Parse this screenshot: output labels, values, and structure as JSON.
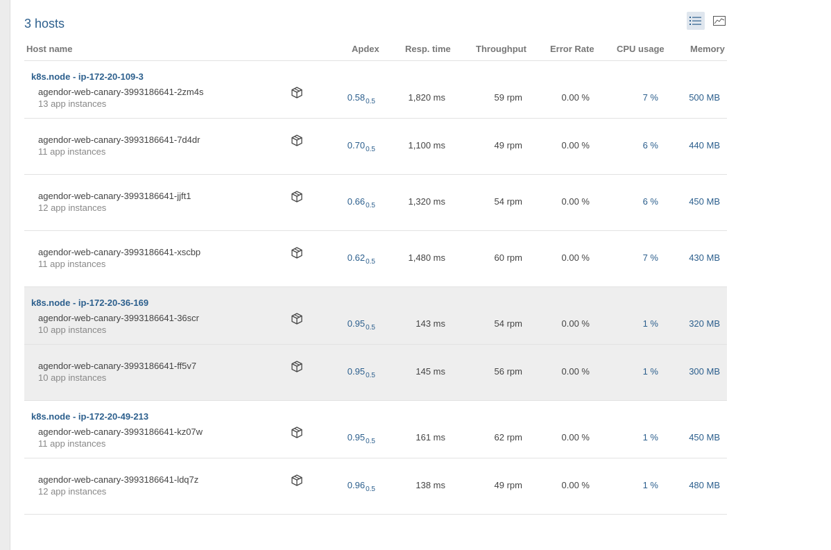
{
  "header": {
    "title": "3 hosts",
    "list_view_icon": "list-icon",
    "chart_view_icon": "chart-icon"
  },
  "columns": {
    "host_name": "Host name",
    "apdex": "Apdex",
    "resp_time": "Resp. time",
    "throughput": "Throughput",
    "error_rate": "Error Rate",
    "cpu_usage": "CPU usage",
    "memory": "Memory"
  },
  "rows": [
    {
      "host": "k8s.node - ip-172-20-109-3",
      "name": "agendor-web-canary-3993186641-2zm4s",
      "instances": "13 app instances",
      "apdex": "0.58",
      "apdex_t": "0.5",
      "resp": "1,820 ms",
      "thr": "59 rpm",
      "err": "0.00 %",
      "cpu": "7 %",
      "mem": "500 MB"
    },
    {
      "host": "",
      "name": "agendor-web-canary-3993186641-7d4dr",
      "instances": "11 app instances",
      "apdex": "0.70",
      "apdex_t": "0.5",
      "resp": "1,100 ms",
      "thr": "49 rpm",
      "err": "0.00 %",
      "cpu": "6 %",
      "mem": "440 MB"
    },
    {
      "host": "",
      "name": "agendor-web-canary-3993186641-jjft1",
      "instances": "12 app instances",
      "apdex": "0.66",
      "apdex_t": "0.5",
      "resp": "1,320 ms",
      "thr": "54 rpm",
      "err": "0.00 %",
      "cpu": "6 %",
      "mem": "450 MB"
    },
    {
      "host": "",
      "name": "agendor-web-canary-3993186641-xscbp",
      "instances": "11 app instances",
      "apdex": "0.62",
      "apdex_t": "0.5",
      "resp": "1,480 ms",
      "thr": "60 rpm",
      "err": "0.00 %",
      "cpu": "7 %",
      "mem": "430 MB"
    },
    {
      "host": "k8s.node - ip-172-20-36-169",
      "name": "agendor-web-canary-3993186641-36scr",
      "instances": "10 app instances",
      "apdex": "0.95",
      "apdex_t": "0.5",
      "resp": "143 ms",
      "thr": "54 rpm",
      "err": "0.00 %",
      "cpu": "1 %",
      "mem": "320 MB"
    },
    {
      "host": "",
      "name": "agendor-web-canary-3993186641-ff5v7",
      "instances": "10 app instances",
      "apdex": "0.95",
      "apdex_t": "0.5",
      "resp": "145 ms",
      "thr": "56 rpm",
      "err": "0.00 %",
      "cpu": "1 %",
      "mem": "300 MB"
    },
    {
      "host": "k8s.node - ip-172-20-49-213",
      "name": "agendor-web-canary-3993186641-kz07w",
      "instances": "11 app instances",
      "apdex": "0.95",
      "apdex_t": "0.5",
      "resp": "161 ms",
      "thr": "62 rpm",
      "err": "0.00 %",
      "cpu": "1 %",
      "mem": "450 MB"
    },
    {
      "host": "",
      "name": "agendor-web-canary-3993186641-ldq7z",
      "instances": "12 app instances",
      "apdex": "0.96",
      "apdex_t": "0.5",
      "resp": "138 ms",
      "thr": "49 rpm",
      "err": "0.00 %",
      "cpu": "1 %",
      "mem": "480 MB"
    }
  ],
  "colors": {
    "link": "#2c5f8d",
    "shaded_row": "#eeeeee",
    "active_toggle": "#dfe6ee"
  }
}
